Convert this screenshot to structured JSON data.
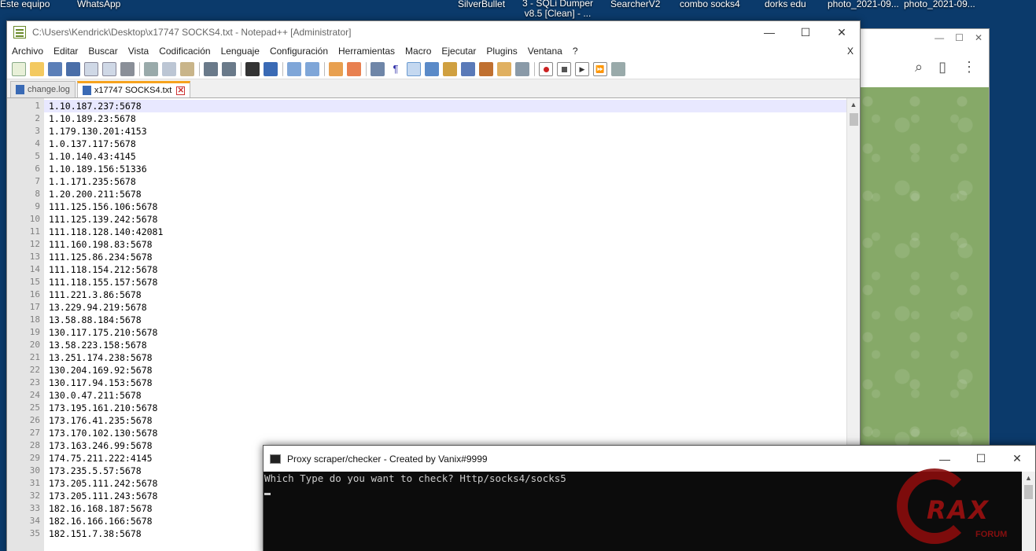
{
  "desktop": {
    "icons_top": [
      {
        "label": "Este equipo"
      },
      {
        "label": "WhatsApp"
      },
      {
        "label": "SilverBullet"
      },
      {
        "label": "3 - SQLi Dumper v8.5 [Clean] - ..."
      },
      {
        "label": "SearcherV2"
      },
      {
        "label": "combo socks4"
      },
      {
        "label": "dorks edu"
      },
      {
        "label": "photo_2021-09..."
      },
      {
        "label": "photo_2021-09..."
      }
    ]
  },
  "notepad": {
    "title": "C:\\Users\\Kendrick\\Desktop\\x17747 SOCKS4.txt - Notepad++ [Administrator]",
    "menu": [
      "Archivo",
      "Editar",
      "Buscar",
      "Vista",
      "Codificación",
      "Lenguaje",
      "Configuración",
      "Herramientas",
      "Macro",
      "Ejecutar",
      "Plugins",
      "Ventana",
      "?"
    ],
    "menu_close": "X",
    "tabs": [
      {
        "label": "change.log"
      },
      {
        "label": "x17747 SOCKS4.txt"
      }
    ],
    "lines": [
      "1.10.187.237:5678",
      "1.10.189.23:5678",
      "1.179.130.201:4153",
      "1.0.137.117:5678",
      "1.10.140.43:4145",
      "1.10.189.156:51336",
      "1.1.171.235:5678",
      "1.20.200.211:5678",
      "111.125.156.106:5678",
      "111.125.139.242:5678",
      "111.118.128.140:42081",
      "111.160.198.83:5678",
      "111.125.86.234:5678",
      "111.118.154.212:5678",
      "111.118.155.157:5678",
      "111.221.3.86:5678",
      "13.229.94.219:5678",
      "13.58.88.184:5678",
      "130.117.175.210:5678",
      "13.58.223.158:5678",
      "13.251.174.238:5678",
      "130.204.169.92:5678",
      "130.117.94.153:5678",
      "130.0.47.211:5678",
      "173.195.161.210:5678",
      "173.176.41.235:5678",
      "173.170.102.130:5678",
      "173.163.246.99:5678",
      "174.75.211.222:4145",
      "173.235.5.57:5678",
      "173.205.111.242:5678",
      "173.205.111.243:5678",
      "182.16.168.187:5678",
      "182.16.166.166:5678",
      "182.151.7.38:5678"
    ]
  },
  "console": {
    "title": "Proxy scraper/checker - Created by Vanix#9999",
    "prompt": "Which Type do you want to check? Http/socks4/socks5"
  },
  "watermark": {
    "text": "RAX",
    "sub": "FORUM"
  },
  "colors": {
    "desktop_bg": "#0b3a6b",
    "tab_accent": "#f6a31e",
    "gutter_bg": "#e4e4e4",
    "console_bg": "#0c0c0c",
    "chat_bg": "#86a968"
  }
}
